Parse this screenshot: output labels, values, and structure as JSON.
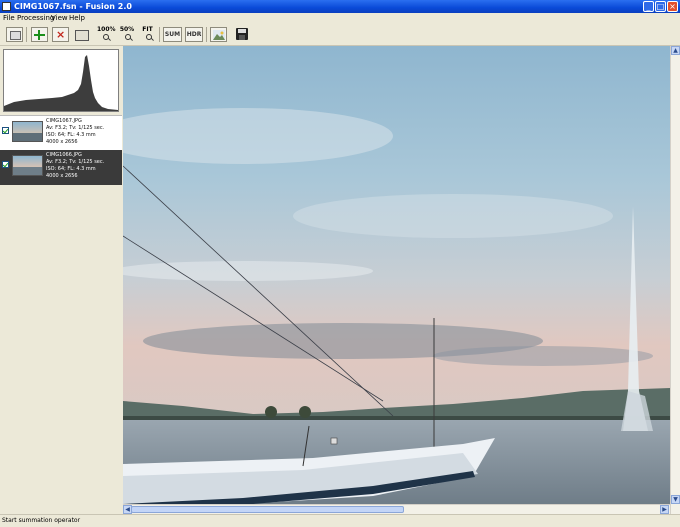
{
  "window": {
    "title": "CIMG1067.fsn - Fusion 2.0",
    "controls": [
      "minimize",
      "maximize",
      "close"
    ]
  },
  "menu": [
    "File",
    "Processing",
    "View",
    "Help"
  ],
  "toolbar": {
    "zoom_100_label": "100%",
    "zoom_50_label": "50%",
    "zoom_fit_label": "FIT",
    "sum_label": "SUM",
    "hdr_label": "HDR",
    "icons": [
      "blank-frame-icon",
      "add-image-icon",
      "remove-image-icon",
      "crop-icon",
      "zoom-100-icon",
      "zoom-50-icon",
      "zoom-fit-icon",
      "sum-icon",
      "hdr-icon",
      "landscape-icon",
      "save-icon"
    ]
  },
  "images": [
    {
      "filename": "CIMG1067.JPG",
      "exposure": "Av: F3.2; Tv: 1/125 sec.",
      "iso_fl": "ISO: 64; FL: 4.3 mm",
      "size": "4000 x 2656",
      "checked": true,
      "selected": false
    },
    {
      "filename": "CIMG1066.JPG",
      "exposure": "Av: F3.2; Tv: 1/125 sec.",
      "iso_fl": "ISO: 64; FL: 4.3 mm",
      "size": "4000 x 2656",
      "checked": true,
      "selected": true
    }
  ],
  "status": "Start summation operator",
  "colors": {
    "titlebar": "#0a4ad8",
    "chrome": "#ece9d8",
    "selection": "#3a3a3a",
    "sky_top": "#8fb6cf",
    "water": "#8c9aa6"
  }
}
